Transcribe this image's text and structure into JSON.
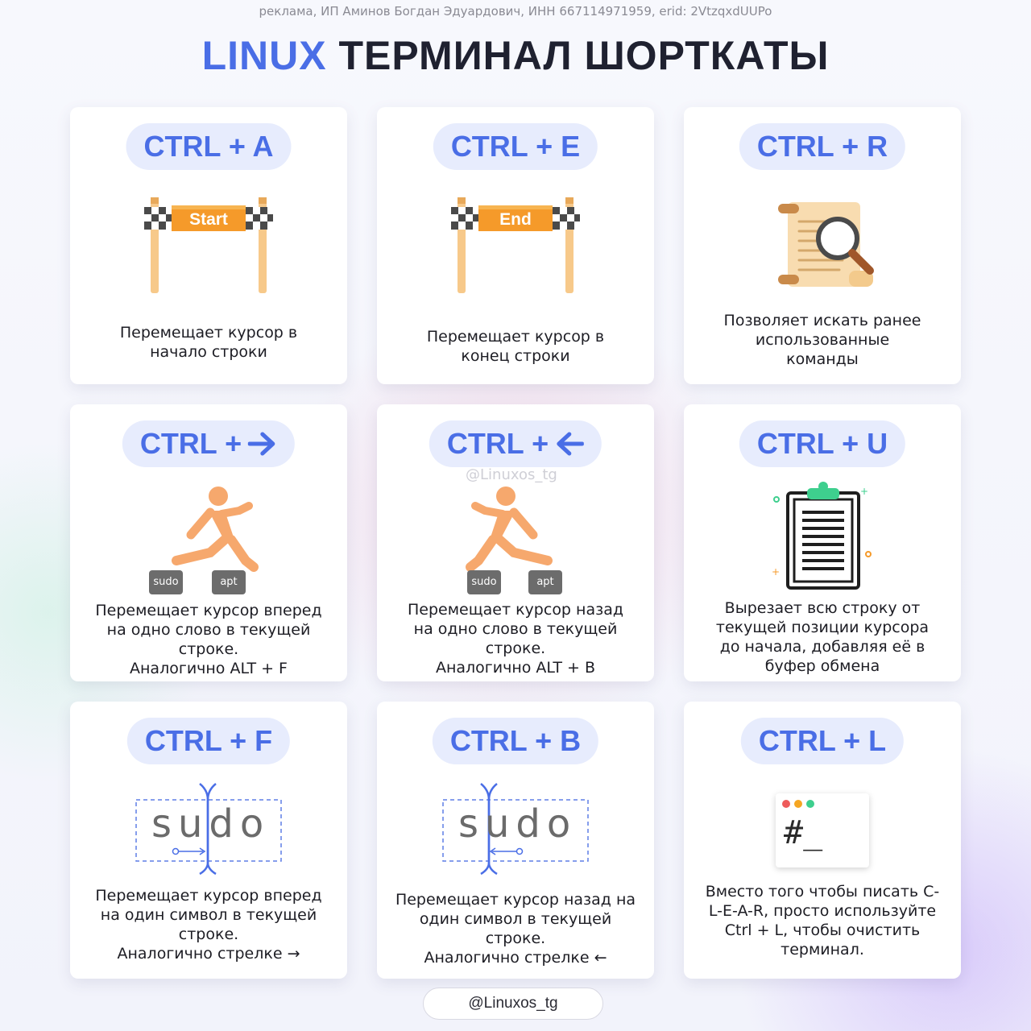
{
  "ad_line": "реклама, ИП Аминов Богдан Эдуардович, ИНН 667114971959, erid: 2VtzqxdUUPo",
  "title": {
    "accent": "LINUX",
    "rest": "ТЕРМИНАЛ ШОРТКАТЫ"
  },
  "accent_color": "#4a6ee6",
  "cards": [
    {
      "shortcut": "CTRL + A",
      "icon": "start-gate-icon",
      "gate_label": "Start",
      "desc": [
        "Перемещает курсор в",
        "начало строки"
      ]
    },
    {
      "shortcut": "CTRL + E",
      "icon": "end-gate-icon",
      "gate_label": "End",
      "desc": [
        "Перемещает курсор в",
        "конец строки"
      ]
    },
    {
      "shortcut": "CTRL + R",
      "icon": "scroll-magnifier-icon",
      "desc": [
        "Позволяет искать ранее",
        "использованные",
        "команды"
      ]
    },
    {
      "shortcut": "CTRL + ",
      "icon": "runner-forward-icon",
      "arrow": "right-arrow-icon",
      "tags": [
        "sudo",
        "apt"
      ],
      "desc": [
        "Перемещает курсор вперед",
        "на одно слово в текущей",
        "строке.",
        "Аналогично ALT + F"
      ]
    },
    {
      "shortcut": "CTRL +",
      "icon": "runner-backward-icon",
      "arrow": "left-arrow-icon",
      "tags": [
        "sudo",
        "apt"
      ],
      "desc": [
        "Перемещает курсор назад",
        "на одно слово в текущей",
        "строке.",
        "Аналогично ALT + B"
      ]
    },
    {
      "shortcut": "CTRL + U",
      "icon": "clipboard-icon",
      "desc": [
        "Вырезает всю строку от",
        "текущей позиции курсора",
        "до начала, добавляя её в",
        "буфер обмена"
      ]
    },
    {
      "shortcut": "CTRL + F",
      "icon": "cursor-forward-icon",
      "word": "sudo",
      "desc": [
        "Перемещает курсор вперед",
        "на один символ в текущей",
        "строке.",
        "Аналогично стрелке →"
      ]
    },
    {
      "shortcut": "CTRL + B",
      "icon": "cursor-backward-icon",
      "word": "sudo",
      "desc": [
        "Перемещает курсор назад на",
        "один символ в текущей",
        "строке.",
        "Аналогично стрелке ←"
      ]
    },
    {
      "shortcut": "CTRL + L",
      "icon": "terminal-window-icon",
      "prompt": "#_",
      "desc": [
        "Вместо того чтобы писать C-",
        "L-E-A-R, просто используйте",
        "Ctrl + L, чтобы очистить",
        "терминал."
      ]
    }
  ],
  "watermark": "@Linuxos_tg",
  "footer_handle": "@Linuxos_tg"
}
